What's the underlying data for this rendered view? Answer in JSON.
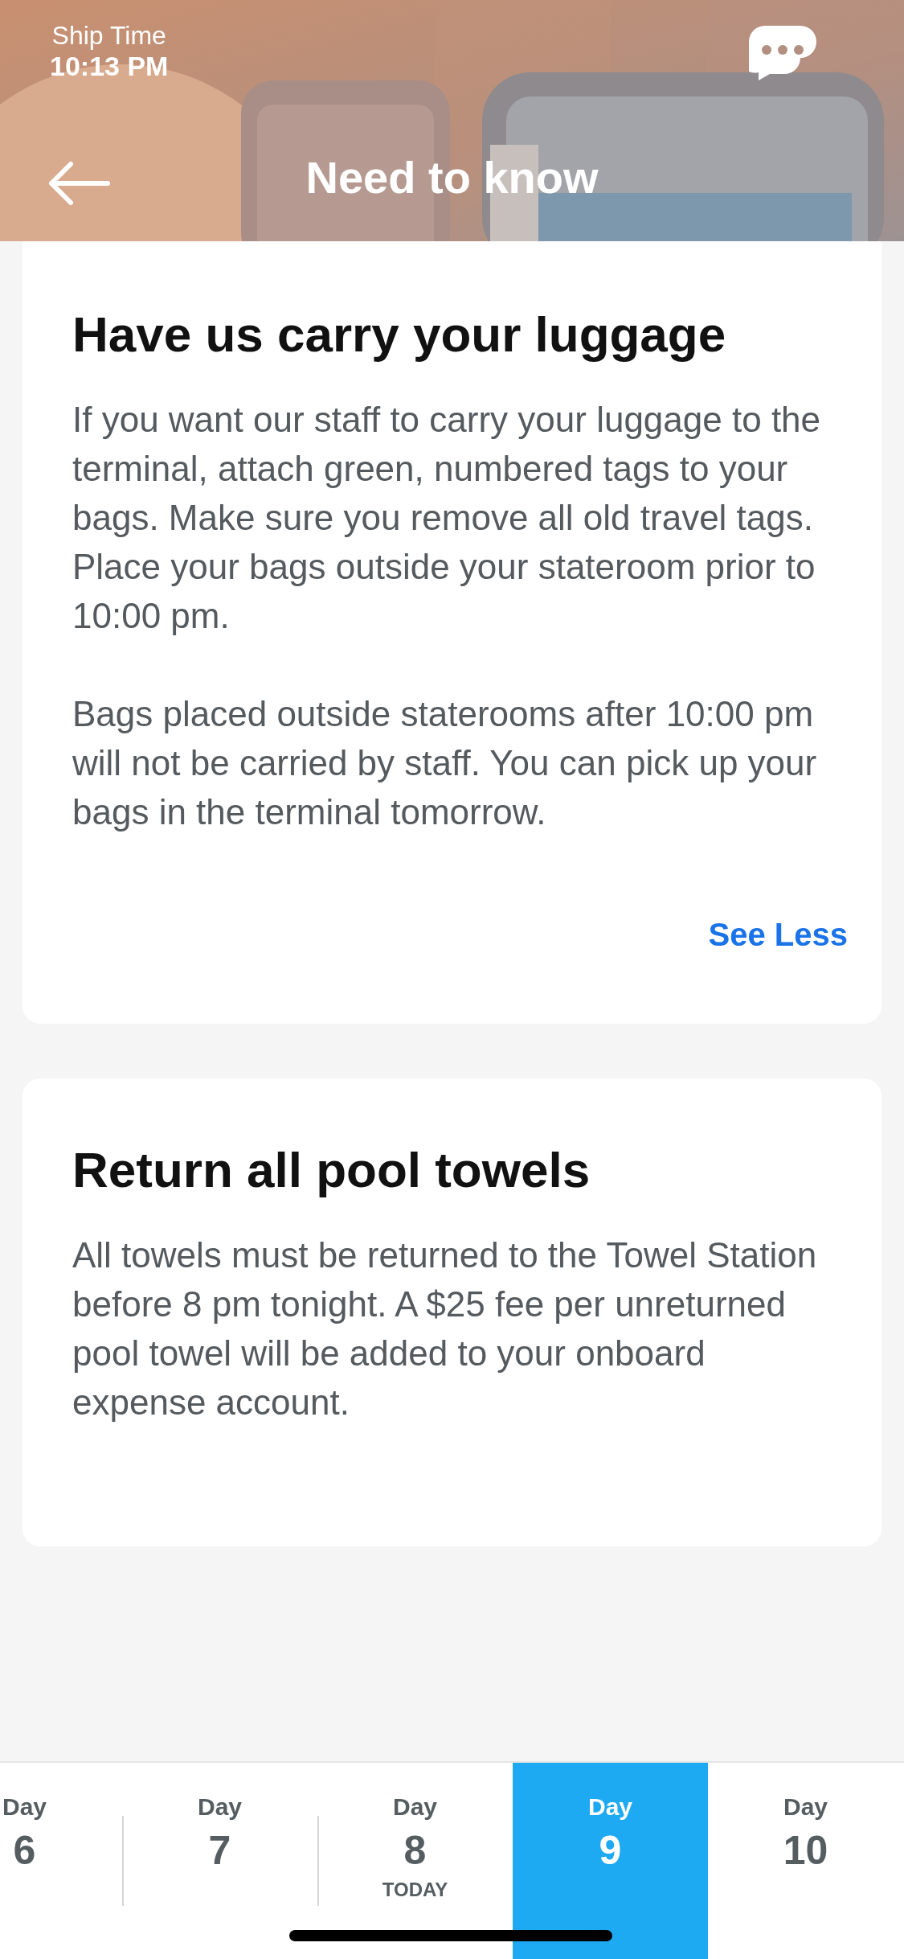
{
  "header": {
    "ship_time_label": "Ship Time",
    "ship_time": "10:13 PM",
    "title": "Need to know"
  },
  "cards": [
    {
      "title": "Have us carry your luggage",
      "paragraphs": [
        "If you want our staff to carry your luggage to the terminal, attach green, numbered tags to your bags. Make sure you remove all old travel tags. Place your bags outside your stateroom prior to 10:00 pm.",
        "Bags placed outside staterooms after 10:00 pm will not be carried by staff. You can pick up your bags in the terminal tomorrow."
      ],
      "link": "See Less"
    },
    {
      "title": "Return all pool towels",
      "paragraphs": [
        "All towels must be returned to the Towel Station before 8 pm tonight. A $25 fee per unreturned pool towel will be added to your onboard expense account."
      ]
    }
  ],
  "days": [
    {
      "label": "Day",
      "number": "6",
      "selected": false
    },
    {
      "label": "Day",
      "number": "7",
      "selected": false
    },
    {
      "label": "Day",
      "number": "8",
      "note": "TODAY",
      "selected": false
    },
    {
      "label": "Day",
      "number": "9",
      "selected": true
    },
    {
      "label": "Day",
      "number": "10",
      "selected": false
    }
  ]
}
